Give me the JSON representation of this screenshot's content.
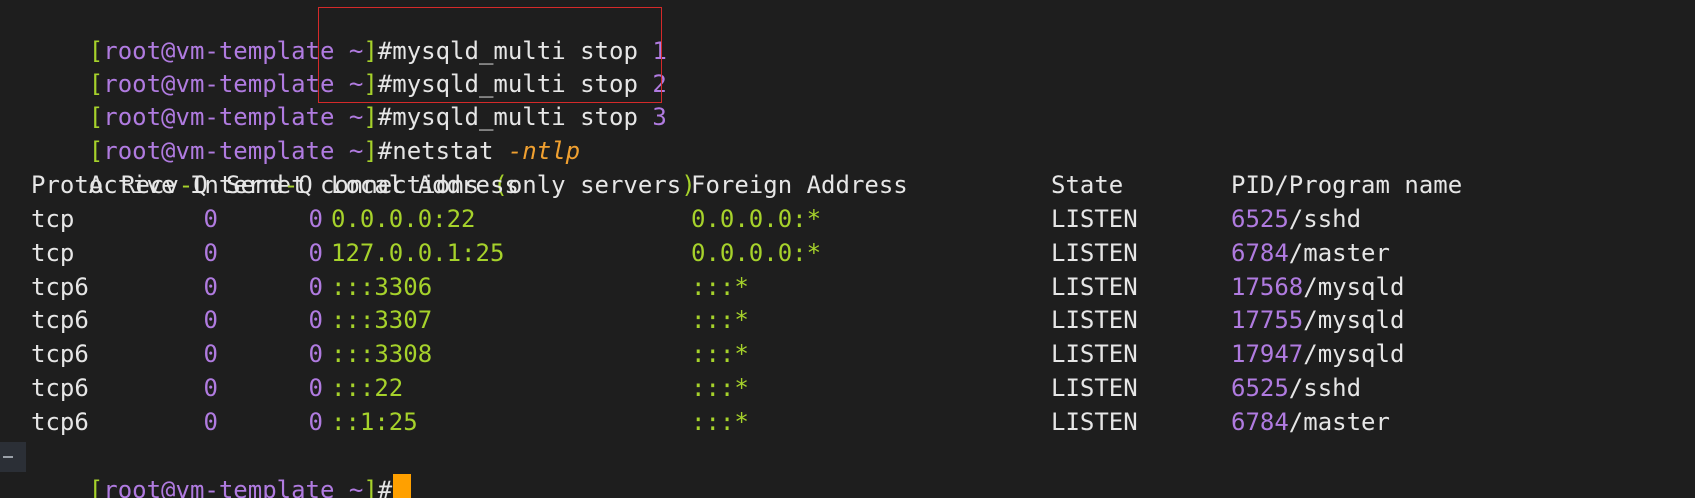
{
  "prompt": {
    "open_bracket": "[",
    "user_host": "root@vm-template",
    "space": " ",
    "tilde": "~",
    "close_bracket": "]",
    "hash": "#"
  },
  "commands": [
    {
      "cmd": "mysqld_multi stop ",
      "arg": "1"
    },
    {
      "cmd": "mysqld_multi stop ",
      "arg": "2"
    },
    {
      "cmd": "mysqld_multi stop ",
      "arg": "3"
    },
    {
      "cmd": "netstat ",
      "arg": "-ntlp"
    }
  ],
  "netstat": {
    "title_pre": "Active Internet connections ",
    "title_open": "(",
    "title_mid": "only servers",
    "title_close": ")",
    "headers": {
      "proto": "Proto",
      "recvq_pre": "Recv",
      "recvq_dash": "-",
      "recvq_post": "Q",
      "sendq_pre": "Send",
      "sendq_dash": "-",
      "sendq_post": "Q",
      "local": "Local Address",
      "foreign": "Foreign Address",
      "state": "State",
      "pid": "PID/Program name"
    },
    "rows": [
      {
        "proto": "tcp",
        "recvq": "0",
        "sendq": "0",
        "local": "0.0.0.0:22",
        "foreign": "0.0.0.0:*",
        "state": "LISTEN",
        "pid": "6525",
        "prog": "/sshd"
      },
      {
        "proto": "tcp",
        "recvq": "0",
        "sendq": "0",
        "local": "127.0.0.1:25",
        "foreign": "0.0.0.0:*",
        "state": "LISTEN",
        "pid": "6784",
        "prog": "/master"
      },
      {
        "proto": "tcp6",
        "recvq": "0",
        "sendq": "0",
        "local": ":::3306",
        "foreign": ":::*",
        "state": "LISTEN",
        "pid": "17568",
        "prog": "/mysqld"
      },
      {
        "proto": "tcp6",
        "recvq": "0",
        "sendq": "0",
        "local": ":::3307",
        "foreign": ":::*",
        "state": "LISTEN",
        "pid": "17755",
        "prog": "/mysqld"
      },
      {
        "proto": "tcp6",
        "recvq": "0",
        "sendq": "0",
        "local": ":::3308",
        "foreign": ":::*",
        "state": "LISTEN",
        "pid": "17947",
        "prog": "/mysqld"
      },
      {
        "proto": "tcp6",
        "recvq": "0",
        "sendq": "0",
        "local": ":::22",
        "foreign": ":::*",
        "state": "LISTEN",
        "pid": "6525",
        "prog": "/sshd"
      },
      {
        "proto": "tcp6",
        "recvq": "0",
        "sendq": "0",
        "local": "::1:25",
        "foreign": ":::*",
        "state": "LISTEN",
        "pid": "6784",
        "prog": "/master"
      }
    ]
  },
  "colors": {
    "background": "#1e1e1e",
    "foreground": "#e6e6e6",
    "accent_purple": "#b07be0",
    "accent_green": "#a6d22b",
    "flag_orange": "#f0a030",
    "cursor": "#ffa000",
    "highlight_border": "#d42a2a"
  },
  "icons": {
    "cursor": "block-cursor",
    "gutter_marker": "dash-marker-icon"
  }
}
